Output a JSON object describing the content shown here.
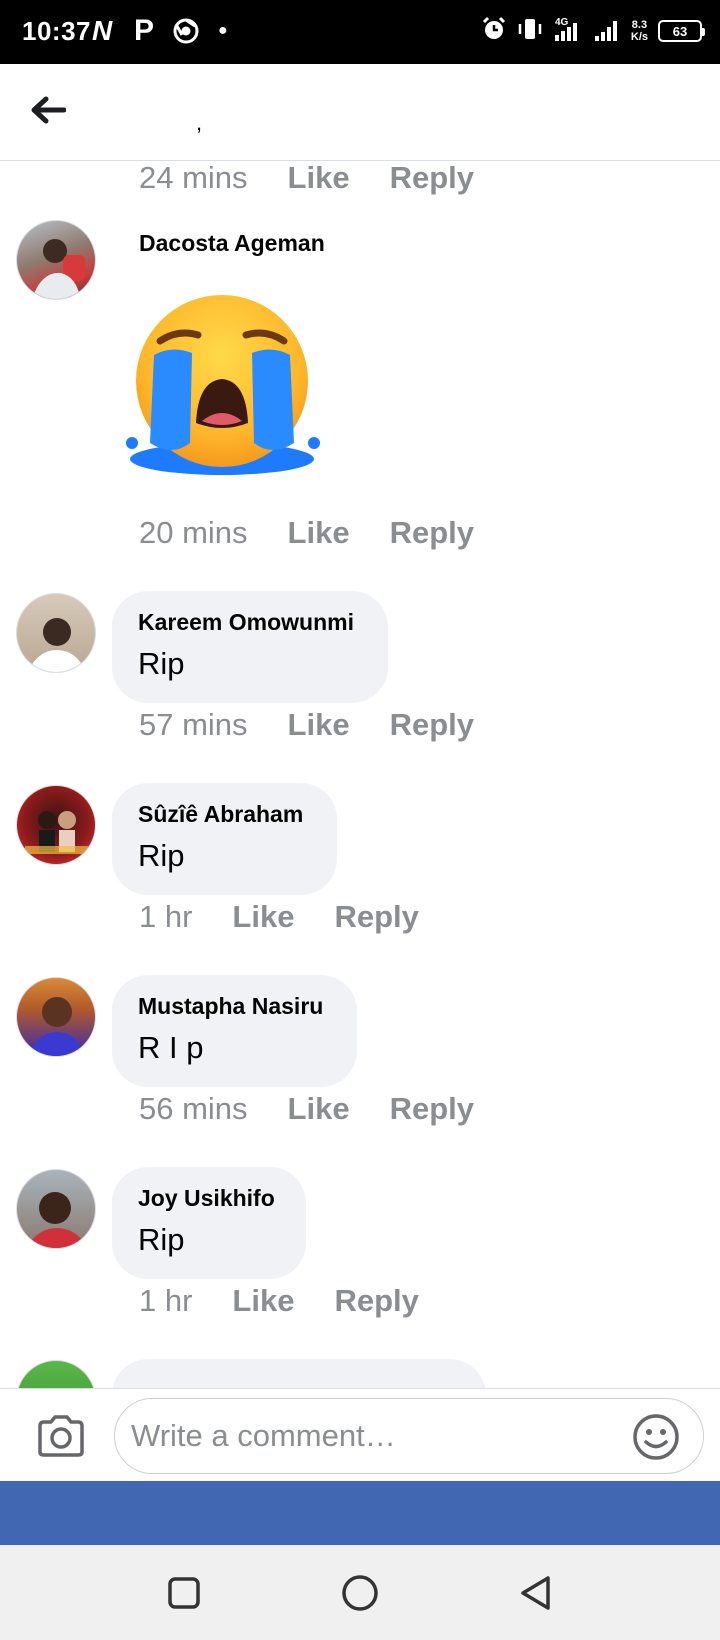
{
  "status_bar": {
    "time": "10:37",
    "net_speed_value": "8.3",
    "net_speed_unit": "K/s",
    "network_type": "4G",
    "battery": "63",
    "notification_icons": [
      "netflix-n-icon",
      "pinterest-p-icon",
      "chrome-icon",
      "dot-icon"
    ]
  },
  "header": {
    "title": ","
  },
  "comments": [
    {
      "type": "meta-only",
      "time": "24 mins",
      "like": "Like",
      "reply": "Reply"
    },
    {
      "type": "sticker",
      "author": "Dacosta Ageman",
      "sticker": "loudly-crying-face",
      "time": "20 mins",
      "like": "Like",
      "reply": "Reply"
    },
    {
      "type": "text",
      "author": "Kareem Omowunmi",
      "text": "Rip",
      "time": "57 mins",
      "like": "Like",
      "reply": "Reply"
    },
    {
      "type": "text",
      "author": "Sûzîê Abraham",
      "text": "Rip",
      "time": "1 hr",
      "like": "Like",
      "reply": "Reply"
    },
    {
      "type": "text",
      "author": "Mustapha Nasiru",
      "text": "R I p",
      "time": "56 mins",
      "like": "Like",
      "reply": "Reply"
    },
    {
      "type": "text",
      "author": "Joy Usikhifo",
      "text": "Rip",
      "time": "1 hr",
      "like": "Like",
      "reply": "Reply"
    }
  ],
  "composer": {
    "placeholder": "Write a comment…"
  },
  "colors": {
    "accent": "#4267b2",
    "bubble": "#f0f2f5",
    "meta_text": "#8a8d91"
  }
}
